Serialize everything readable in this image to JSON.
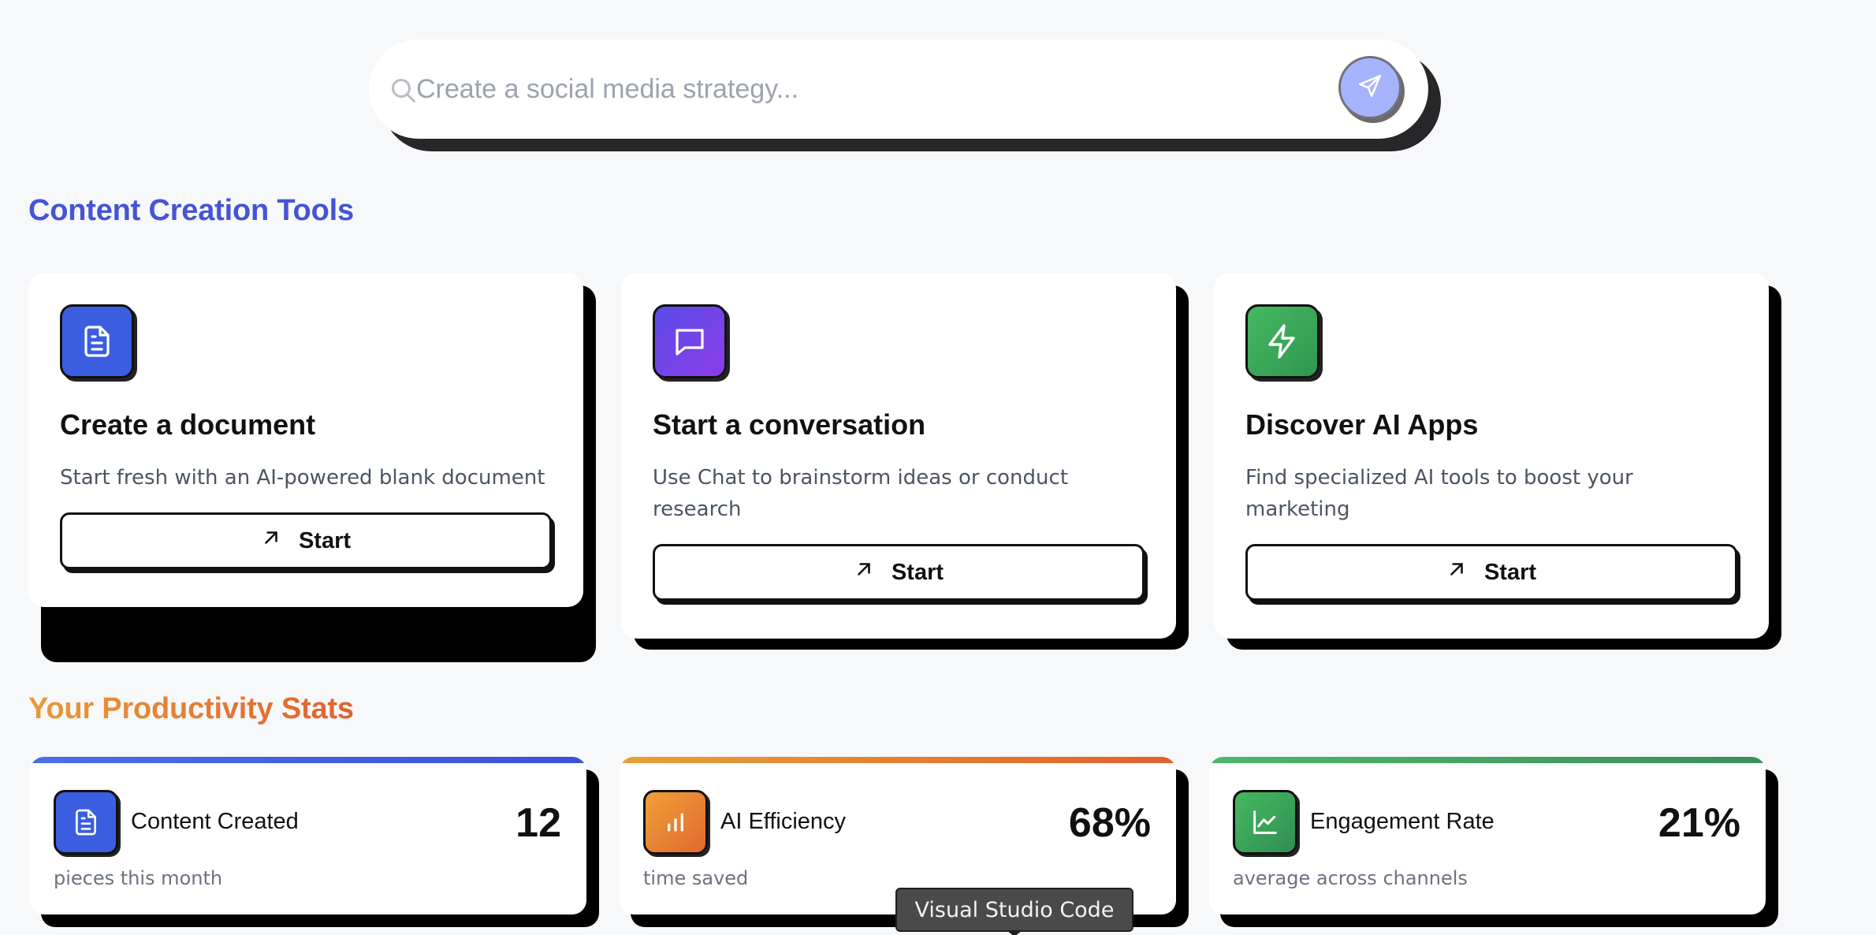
{
  "search": {
    "placeholder": "Create a social media strategy..."
  },
  "sections": {
    "tools_title": "Content Creation Tools",
    "stats_title": "Your Productivity Stats"
  },
  "tools": [
    {
      "title": "Create a document",
      "description": "Start fresh with an AI-powered blank document",
      "button_label": "Start",
      "icon": "document-icon",
      "color": "#3b5ee0"
    },
    {
      "title": "Start a conversation",
      "description": "Use Chat to brainstorm ideas or conduct research",
      "button_label": "Start",
      "icon": "chat-bubble-icon",
      "color": "#6d4ae6"
    },
    {
      "title": "Discover AI Apps",
      "description": "Find specialized AI tools to boost your marketing",
      "button_label": "Start",
      "icon": "lightning-icon",
      "color": "#3fa85a"
    }
  ],
  "stats": [
    {
      "label": "Content Created",
      "value": "12",
      "subtitle": "pieces this month",
      "icon": "document-icon",
      "color": "#3b5ee0"
    },
    {
      "label": "AI Efficiency",
      "value": "68%",
      "subtitle": "time saved",
      "icon": "bar-chart-icon",
      "color": "#e8822e"
    },
    {
      "label": "Engagement Rate",
      "value": "21%",
      "subtitle": "average across channels",
      "icon": "line-chart-icon",
      "color": "#3fa85a"
    }
  ],
  "tooltip": {
    "text": "Visual Studio Code"
  }
}
